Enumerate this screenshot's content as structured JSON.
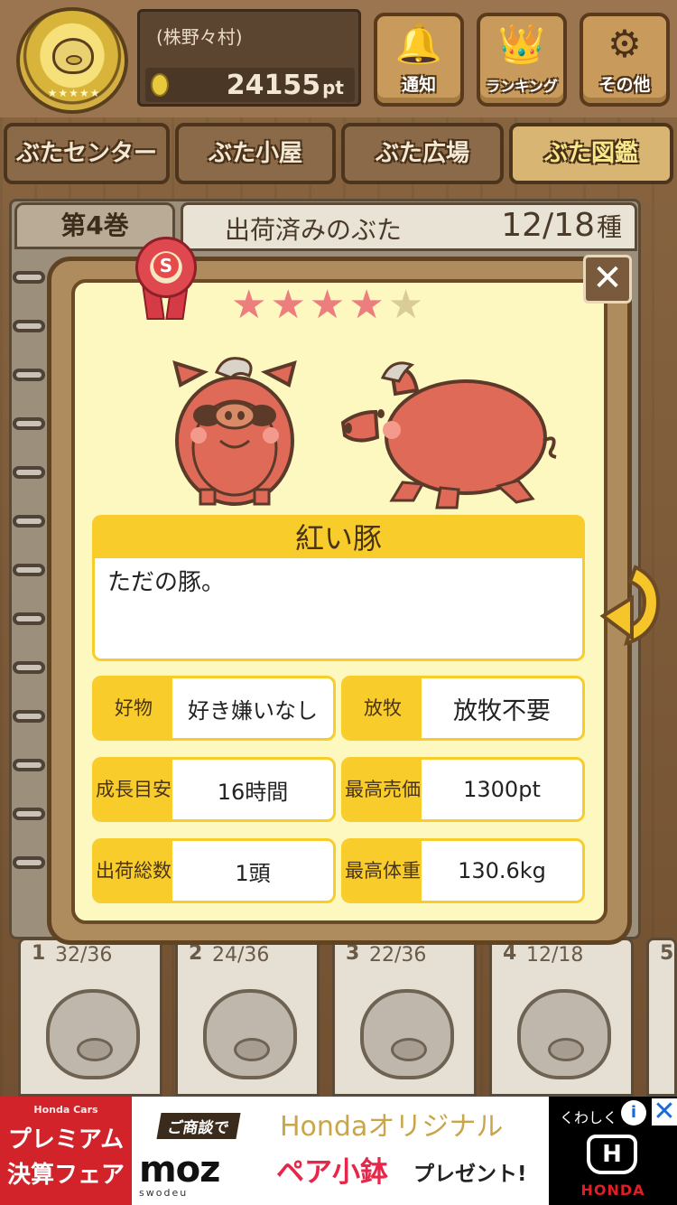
{
  "header": {
    "username": "(株野々村)",
    "points": "24155",
    "points_unit": "pt",
    "badge_stars": "★★★★★",
    "buttons": [
      {
        "label": "通知",
        "icon": "bell-icon"
      },
      {
        "label": "ランキング",
        "icon": "crown-icon"
      },
      {
        "label": "その他",
        "icon": "gear-icon"
      }
    ]
  },
  "tabs": [
    "ぶたセンター",
    "ぶた小屋",
    "ぶた広場",
    "ぶた図鑑"
  ],
  "active_tab": "ぶた図鑑",
  "album": {
    "volume": "第4巻",
    "shipped_label": "出荷済みのぶた",
    "shipped_count": "12/18",
    "shipped_unit": "種"
  },
  "modal": {
    "rank": "S",
    "rating": 4,
    "rating_max": 5,
    "name": "紅い豚",
    "description": "ただの豚。",
    "stats": [
      {
        "key": "好物",
        "value": "好き嫌いなし"
      },
      {
        "key": "放牧",
        "value": "放牧不要"
      },
      {
        "key": "成長目安",
        "key_l1": "成長",
        "key_l2": "目安",
        "value": "16時間"
      },
      {
        "key": "最高売価",
        "key_l1": "最高",
        "key_l2": "売価",
        "value": "1300pt"
      },
      {
        "key": "出荷総数",
        "key_l1": "出荷",
        "key_l2": "総数",
        "value": "1頭"
      },
      {
        "key": "最高体重",
        "key_l1": "最高",
        "key_l2": "体重",
        "value": "130.6kg"
      }
    ],
    "close_symbol": "✕"
  },
  "books": [
    {
      "num": "1",
      "count": "32/36"
    },
    {
      "num": "2",
      "count": "24/36"
    },
    {
      "num": "3",
      "count": "22/36"
    },
    {
      "num": "4",
      "count": "12/18"
    },
    {
      "num": "5",
      "count": ""
    }
  ],
  "ad": {
    "left_small": "Honda Cars",
    "left_l1": "プレミアム",
    "left_l2": "決算フェア",
    "tag": "ご商談で",
    "headline": "Hondaオリジナル",
    "brand": "moz",
    "brand_sub": "swodeu",
    "offer": "ペア小鉢",
    "offer_suffix": "プレゼント!",
    "right_small": "くわしく",
    "right_brand": "HONDA",
    "info": "i",
    "close": "✕"
  },
  "colors": {
    "accent_yellow": "#f8cd2b",
    "star_on": "#ec7e7e",
    "star_off": "#d9cc97",
    "pig_red": "#e06a58"
  }
}
